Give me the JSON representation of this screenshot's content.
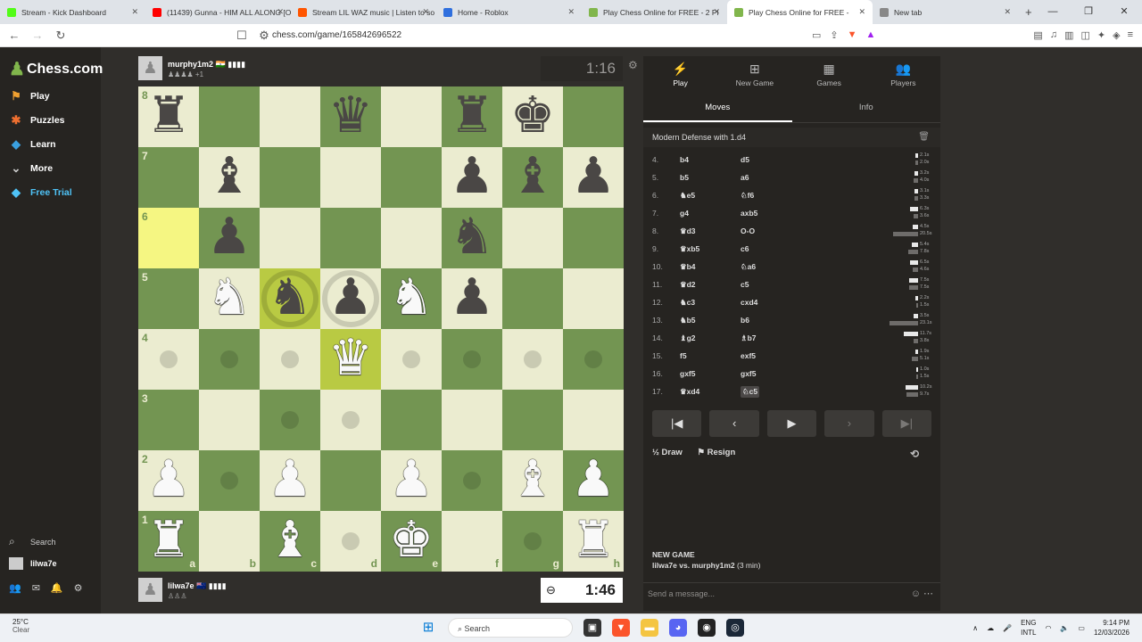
{
  "browser": {
    "tabs": [
      {
        "title": "Stream - Kick Dashboard",
        "color": "#53fc18",
        "active": false
      },
      {
        "title": "(11439) Gunna - HIM ALL ALONG [O",
        "color": "#ff0000",
        "active": false
      },
      {
        "title": "Stream LIL WAZ music | Listen to so",
        "color": "#ff5500",
        "active": false
      },
      {
        "title": "Home - Roblox",
        "color": "#2f6fde",
        "active": false
      },
      {
        "title": "Play Chess Online for FREE - 2 Pl",
        "color": "#81b64c",
        "active": false
      },
      {
        "title": "Play Chess Online for FREE - ",
        "color": "#81b64c",
        "active": true
      },
      {
        "title": "New tab",
        "color": "#888888",
        "active": false
      }
    ],
    "url": "chess.com/game/165842696522"
  },
  "sidebar": {
    "logo": "Chess.com",
    "items": [
      {
        "label": "Play",
        "icon": "play-icon",
        "color": "#f0a030"
      },
      {
        "label": "Puzzles",
        "icon": "puzzle-icon",
        "color": "#f07030"
      },
      {
        "label": "Learn",
        "icon": "learn-icon",
        "color": "#3aa0e0"
      },
      {
        "label": "More",
        "icon": "chevron-down-icon",
        "color": "#cccccc"
      },
      {
        "label": "Free Trial",
        "icon": "diamond-icon",
        "color": "#4fc3f7"
      }
    ],
    "search": "Search",
    "user": "lilwa7e"
  },
  "game": {
    "top_player": {
      "name": "murphy1m2",
      "flag": "🇮🇳 ▮▮▮▮",
      "sub": "♟♟♟♟ +1",
      "clock": "1:16"
    },
    "bottom_player": {
      "name": "lilwa7e",
      "flag": "🇳🇿 ▮▮▮▮",
      "sub": "♙♙♙",
      "clock": "1:46"
    },
    "board": {
      "rank_labels": [
        "8",
        "7",
        "6",
        "5",
        "4",
        "3",
        "2",
        "1"
      ],
      "file_labels": [
        "a",
        "b",
        "c",
        "d",
        "e",
        "f",
        "g",
        "h"
      ],
      "ranks": [
        [
          "r",
          "",
          "",
          "q",
          "",
          "r",
          "k",
          ""
        ],
        [
          "",
          "b",
          "",
          "",
          "",
          "p",
          "b",
          "p"
        ],
        [
          "",
          "p",
          "",
          "",
          "",
          "n",
          "",
          ""
        ],
        [
          "",
          "N",
          "n",
          "p",
          "N",
          "p",
          "",
          ""
        ],
        [
          "",
          "",
          "",
          "Q",
          "",
          "",
          "",
          ""
        ],
        [
          "",
          "",
          "",
          "",
          "",
          "",
          "",
          ""
        ],
        [
          "P",
          "",
          "P",
          "",
          "P",
          "",
          "B",
          "P"
        ],
        [
          "R",
          "",
          "B",
          "",
          "K",
          "",
          "",
          "R"
        ]
      ],
      "highlight": [
        "a6",
        "c5",
        "d4"
      ],
      "dots": [
        "a4",
        "b4",
        "c4",
        "e4",
        "f4",
        "g4",
        "h4",
        "c3",
        "d3",
        "b2",
        "f2",
        "d1",
        "g1"
      ],
      "rings": [
        "c5",
        "d5"
      ]
    }
  },
  "panel": {
    "tabs": [
      {
        "label": "Play",
        "icon": "play-icon",
        "active": true
      },
      {
        "label": "New Game",
        "icon": "plus-icon",
        "active": false
      },
      {
        "label": "Games",
        "icon": "games-icon",
        "active": false
      },
      {
        "label": "Players",
        "icon": "players-icon",
        "active": false
      }
    ],
    "subtabs": [
      {
        "label": "Moves",
        "active": true
      },
      {
        "label": "Info",
        "active": false
      }
    ],
    "opening": "Modern Defense with 1.d4",
    "moves": [
      {
        "num": "4.",
        "white": "b4",
        "black": "d5",
        "wt": "2.1s",
        "bt": "2.0s",
        "wf": 0.08,
        "bf": 0.08
      },
      {
        "num": "5.",
        "white": "b5",
        "black": "a6",
        "wt": "3.2s",
        "bt": "4.0s",
        "wf": 0.12,
        "bf": 0.15
      },
      {
        "num": "6.",
        "white": "♞e5",
        "black": "♘f6",
        "wt": "3.1s",
        "bt": "3.3s",
        "wf": 0.12,
        "bf": 0.12
      },
      {
        "num": "7.",
        "white": "g4",
        "black": "axb5",
        "wt": "6.3s",
        "bt": "3.6s",
        "wf": 0.24,
        "bf": 0.14
      },
      {
        "num": "8.",
        "white": "♛d3",
        "black": "O-O",
        "wt": "4.5s",
        "bt": "20.5s",
        "wf": 0.17,
        "bf": 0.78
      },
      {
        "num": "9.",
        "white": "♛xb5",
        "black": "c6",
        "wt": "5.4s",
        "bt": "7.8s",
        "wf": 0.2,
        "bf": 0.3
      },
      {
        "num": "10.",
        "white": "♛b4",
        "black": "♘a6",
        "wt": "6.5s",
        "bt": "4.6s",
        "wf": 0.25,
        "bf": 0.17
      },
      {
        "num": "11.",
        "white": "♛d2",
        "black": "c5",
        "wt": "7.5s",
        "bt": "7.5s",
        "wf": 0.28,
        "bf": 0.28
      },
      {
        "num": "12.",
        "white": "♞c3",
        "black": "cxd4",
        "wt": "2.2s",
        "bt": "1.5s",
        "wf": 0.08,
        "bf": 0.06
      },
      {
        "num": "13.",
        "white": "♞b5",
        "black": "b6",
        "wt": "3.5s",
        "bt": "23.1s",
        "wf": 0.13,
        "bf": 0.88
      },
      {
        "num": "14.",
        "white": "♝g2",
        "black": "♗b7",
        "wt": "11.7s",
        "bt": "3.8s",
        "wf": 0.45,
        "bf": 0.14
      },
      {
        "num": "15.",
        "white": "f5",
        "black": "exf5",
        "wt": "1.9s",
        "bt": "5.1s",
        "wf": 0.07,
        "bf": 0.19
      },
      {
        "num": "16.",
        "white": "gxf5",
        "black": "gxf5",
        "wt": "1.0s",
        "bt": "1.5s",
        "wf": 0.04,
        "bf": 0.06
      },
      {
        "num": "17.",
        "white": "♛xd4",
        "black": "♘c5",
        "wt": "10.2s",
        "bt": "9.7s",
        "wf": 0.39,
        "bf": 0.37
      }
    ],
    "actions": {
      "draw": "½ Draw",
      "resign": "⚑ Resign"
    },
    "new_game_title": "NEW GAME",
    "new_game_players": "lilwa7e vs. murphy1m2",
    "new_game_time": "(3 min)",
    "chat_placeholder": "Send a message..."
  },
  "taskbar": {
    "temp": "25°C",
    "weather": "Clear",
    "search": "Search",
    "lang": "ENG",
    "lang_sub": "INTL",
    "time": "9:14 PM",
    "date": "12/03/2026"
  }
}
